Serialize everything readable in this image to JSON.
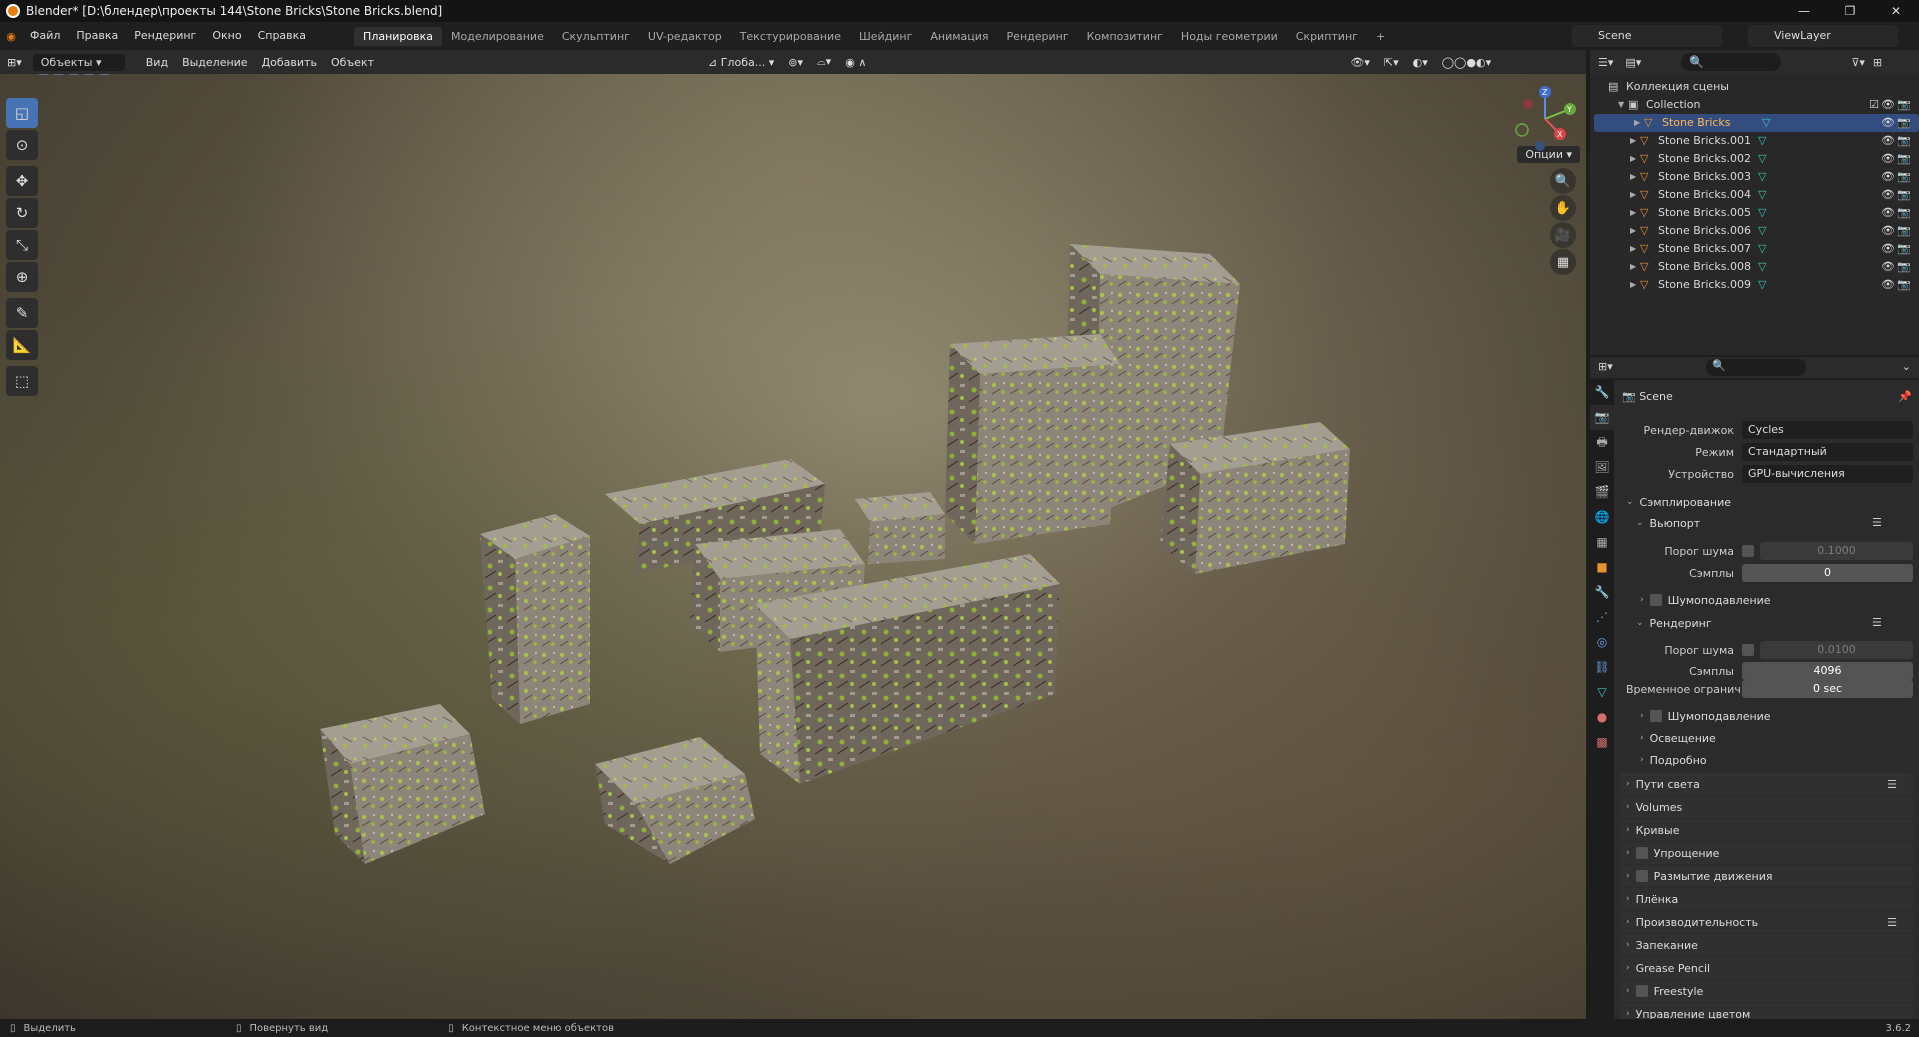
{
  "window": {
    "title": "Blender* [D:\\блендер\\проекты 144\\Stone Bricks\\Stone Bricks.blend]",
    "controls": [
      "—",
      "❐",
      "✕"
    ]
  },
  "menu": [
    "Файл",
    "Правка",
    "Рендеринг",
    "Окно",
    "Справка"
  ],
  "workspaces": [
    "Планировка",
    "Моделирование",
    "Скульптинг",
    "UV-редактор",
    "Текстурирование",
    "Шейдинг",
    "Анимация",
    "Рендеринг",
    "Композитинг",
    "Ноды геометрии",
    "Скриптинг",
    "+"
  ],
  "scene": {
    "name": "Scene",
    "view_layer": "ViewLayer"
  },
  "viewport": {
    "mode": "Объекты",
    "menus": [
      "Вид",
      "Выделение",
      "Добавить",
      "Объект"
    ],
    "transform": "Глоба...",
    "options": "Опции"
  },
  "gizmo": {
    "x": "X",
    "y": "Y",
    "z": "Z"
  },
  "tools": [
    "◱",
    "⊙",
    "✥",
    "↻",
    "⤡",
    "⊕",
    "✎",
    "📐",
    "⬚"
  ],
  "nav_icons": [
    "🔍",
    "✋",
    "🎥",
    "▦"
  ],
  "outliner": {
    "root": "Коллекция сцены",
    "collection": "Collection",
    "items": [
      "Stone Bricks",
      "Stone Bricks.001",
      "Stone Bricks.002",
      "Stone Bricks.003",
      "Stone Bricks.004",
      "Stone Bricks.005",
      "Stone Bricks.006",
      "Stone Bricks.007",
      "Stone Bricks.008",
      "Stone Bricks.009"
    ]
  },
  "properties": {
    "scene_label": "Scene",
    "render_engine_label": "Рендер-движок",
    "render_engine": "Cycles",
    "mode_label": "Режим",
    "mode": "Стандартный",
    "device_label": "Устройство",
    "device": "GPU-вычисления",
    "sampling": "Сэмплирование",
    "viewport": "Вьюпорт",
    "noise_threshold_label": "Порог шума",
    "viewport_noise": "0.1000",
    "samples_label": "Сэмплы",
    "viewport_samples": "0",
    "denoise": "Шумоподавление",
    "render": "Рендеринг",
    "render_noise": "0.0100",
    "render_samples": "4096",
    "time_limit_label": "Временное огранич...",
    "time_limit": "0 sec",
    "render_denoise": "Шумоподавление",
    "lights": "Освещение",
    "advanced": "Подробно",
    "panels": [
      "Пути света",
      "Volumes",
      "Кривые",
      "Упрощение",
      "Размытие движения",
      "Плёнка",
      "Производительность",
      "Запекание",
      "Grease Pencil",
      "Freestyle",
      "Управление цветом"
    ]
  },
  "status": {
    "select": "Выделить",
    "rotate": "Повернуть вид",
    "context": "Контекстное меню объектов",
    "version": "3.6.2"
  }
}
